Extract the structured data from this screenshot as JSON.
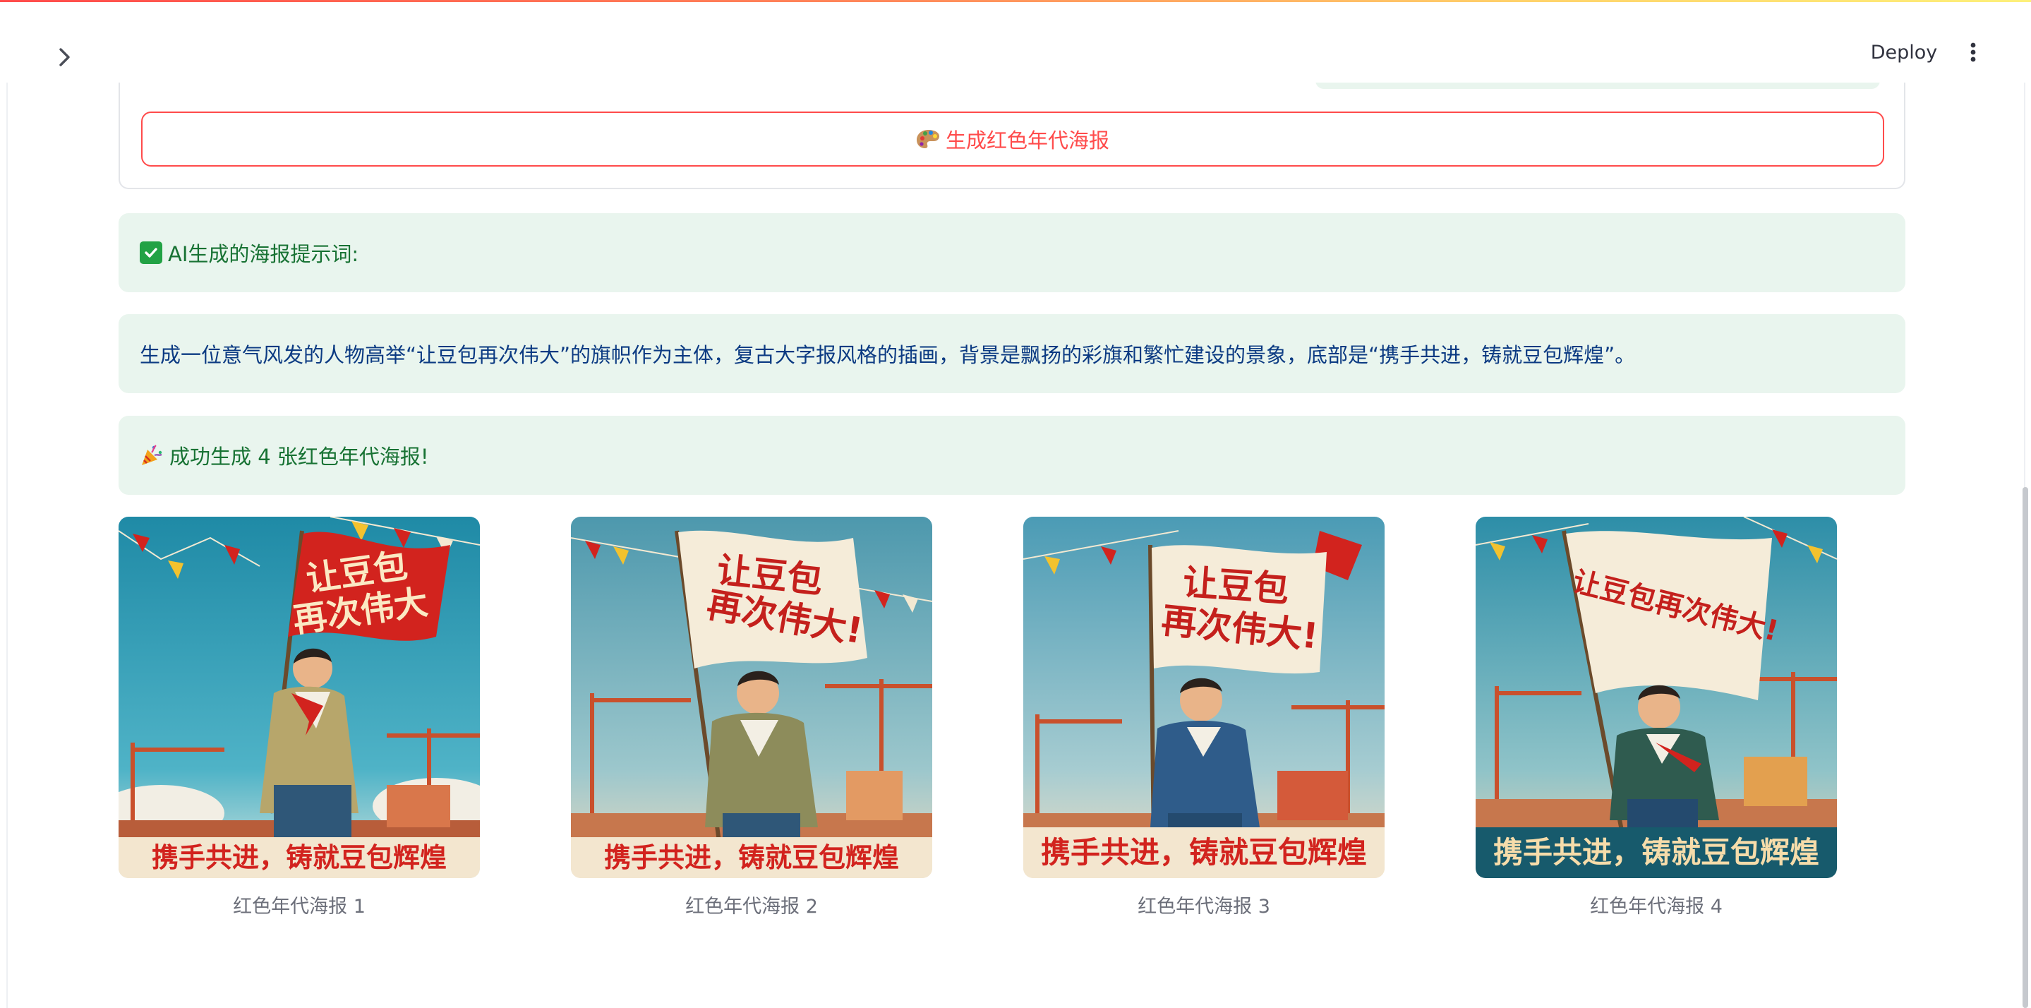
{
  "header": {
    "deploy_label": "Deploy",
    "sidebar_toggle_icon": "chevron-right-icon",
    "menu_icon": "vertical-ellipsis-icon"
  },
  "form": {
    "generate_button_icon": "palette-icon",
    "generate_button_label": "生成红色年代海报"
  },
  "alerts": {
    "prompt_title_icon": "check-mark-icon",
    "prompt_title": "AI生成的海报提示词:",
    "prompt_text": "生成一位意气风发的人物高举“让豆包再次伟大”的旗帜作为主体，复古大字报风格的插画，背景是飘扬的彩旗和繁忙建设的景象，底部是“携手共进，铸就豆包辉煌”。",
    "success_icon": "party-popper-icon",
    "success_text": "成功生成 4 张红色年代海报!"
  },
  "posters": [
    {
      "caption": "红色年代海报 1",
      "flag_text": "让豆包再次伟大",
      "flag_line1": "让豆包",
      "flag_line2": "再次伟大",
      "banner_text": "携手共进，铸就豆包辉煌"
    },
    {
      "caption": "红色年代海报 2",
      "flag_text": "让豆包再次伟大!",
      "flag_line1": "让豆包",
      "flag_line2": "再次伟大!",
      "banner_text": "携手共进，铸就豆包辉煌"
    },
    {
      "caption": "红色年代海报 3",
      "flag_text": "让豆包再次伟大!",
      "flag_line1": "让豆包",
      "flag_line2": "再次伟大!",
      "banner_text": "携手共进，铸就豆包辉煌"
    },
    {
      "caption": "红色年代海报 4",
      "flag_text": "让豆包再次伟大!",
      "flag_line1": "让豆包再次伟大!",
      "banner_text": "携手共进，铸就豆包辉煌"
    }
  ],
  "colors": {
    "accent": "#ff4b4b",
    "success_bg": "#e9f5ee",
    "success_text": "#177233",
    "info_text": "#0b3a82",
    "poster_red": "#d2231e",
    "poster_teal": "#2e8fa8"
  }
}
